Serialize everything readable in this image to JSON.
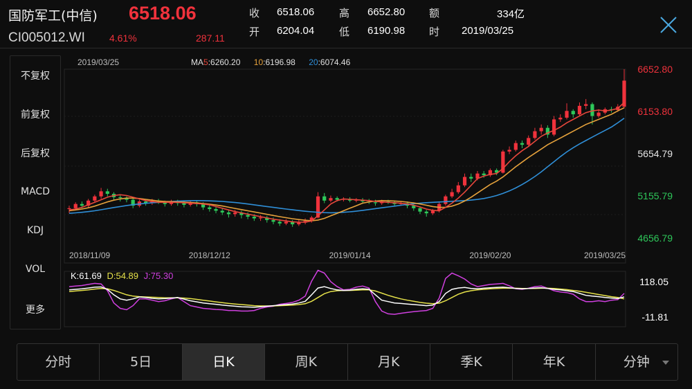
{
  "header": {
    "name": "国防军工(中信)",
    "price": "6518.06",
    "code": "CI005012.WI",
    "change_pct": "4.61%",
    "change_abs": "287.11",
    "stats": [
      {
        "label": "收",
        "value": "6518.06"
      },
      {
        "label": "高",
        "value": "6652.80"
      },
      {
        "label": "额",
        "value": "334亿"
      },
      {
        "label": "开",
        "value": "6204.04"
      },
      {
        "label": "低",
        "value": "6190.98"
      },
      {
        "label": "时",
        "value": "2019/03/25"
      }
    ]
  },
  "sidebar": {
    "items": [
      {
        "label": "不复权",
        "active": true
      },
      {
        "label": "前复权",
        "active": false
      },
      {
        "label": "后复权",
        "active": false
      },
      {
        "label": "MACD",
        "active": false
      },
      {
        "label": "KDJ",
        "active": true
      },
      {
        "label": "VOL",
        "active": false
      },
      {
        "label": "更多",
        "active": false
      }
    ]
  },
  "tabs": [
    {
      "label": "分时",
      "active": false
    },
    {
      "label": "5日",
      "active": false
    },
    {
      "label": "日K",
      "active": true
    },
    {
      "label": "周K",
      "active": false
    },
    {
      "label": "月K",
      "active": false
    },
    {
      "label": "季K",
      "active": false
    },
    {
      "label": "年K",
      "active": false
    },
    {
      "label": "分钟",
      "active": false,
      "dropdown": true
    }
  ],
  "colors": {
    "up": "#f0323c",
    "down": "#2ec85a",
    "ma5": "#e8473c",
    "ma10": "#e6a23c",
    "ma20": "#2f8fd8",
    "k": "#ffffff",
    "d": "#e6e24a",
    "j": "#d040e0",
    "accent": "#3aa0e8"
  },
  "chart_data": [
    {
      "type": "candlestick",
      "top_date": "2019/03/25",
      "ma_legend": [
        {
          "prefix": "MA",
          "key": "5",
          "value": "6260.20"
        },
        {
          "prefix": "",
          "key": "10",
          "value": "6196.98"
        },
        {
          "prefix": "",
          "key": "20",
          "value": "6074.46"
        }
      ],
      "y_ticks": [
        {
          "label": "6652.80",
          "value": 6652.8,
          "color": "up"
        },
        {
          "label": "6153.80",
          "value": 6153.8,
          "color": "up"
        },
        {
          "label": "5654.79",
          "value": 5654.79,
          "color": "neutral"
        },
        {
          "label": "5155.79",
          "value": 5155.79,
          "color": "down"
        },
        {
          "label": "4656.79",
          "value": 4656.79,
          "color": "down"
        }
      ],
      "ylim": [
        4656.79,
        6652.8
      ],
      "x_ticks": [
        {
          "label": "2018/11/09",
          "index": 0
        },
        {
          "label": "2018/12/12",
          "index": 22
        },
        {
          "label": "2019/01/14",
          "index": 44
        },
        {
          "label": "2019/02/20",
          "index": 66
        },
        {
          "label": "2019/03/25",
          "index": 87
        }
      ],
      "candles": [
        [
          5000,
          5010,
          4950,
          5040
        ],
        [
          5010,
          5060,
          4990,
          5080
        ],
        [
          5060,
          5040,
          5010,
          5090
        ],
        [
          5040,
          5100,
          5020,
          5120
        ],
        [
          5100,
          5150,
          5080,
          5170
        ],
        [
          5150,
          5210,
          5120,
          5250
        ],
        [
          5210,
          5180,
          5150,
          5240
        ],
        [
          5180,
          5140,
          5110,
          5200
        ],
        [
          5140,
          5130,
          5090,
          5170
        ],
        [
          5130,
          5110,
          5080,
          5150
        ],
        [
          5110,
          5040,
          5010,
          5130
        ],
        [
          5040,
          5090,
          5020,
          5110
        ],
        [
          5090,
          5070,
          5040,
          5110
        ],
        [
          5070,
          5100,
          5050,
          5120
        ],
        [
          5100,
          5080,
          5060,
          5120
        ],
        [
          5080,
          5060,
          5030,
          5100
        ],
        [
          5060,
          5090,
          5040,
          5110
        ],
        [
          5090,
          5070,
          5040,
          5110
        ],
        [
          5070,
          5050,
          5020,
          5100
        ],
        [
          5050,
          5080,
          5030,
          5100
        ],
        [
          5080,
          5060,
          5030,
          5100
        ],
        [
          5060,
          5020,
          4990,
          5080
        ],
        [
          5020,
          5000,
          4970,
          5050
        ],
        [
          5000,
          4980,
          4950,
          5030
        ],
        [
          4980,
          4960,
          4930,
          5010
        ],
        [
          4960,
          4940,
          4900,
          4990
        ],
        [
          4940,
          4960,
          4910,
          4990
        ],
        [
          4960,
          4930,
          4890,
          4980
        ],
        [
          4930,
          4910,
          4880,
          4960
        ],
        [
          4910,
          4890,
          4860,
          4940
        ],
        [
          4890,
          4900,
          4860,
          4930
        ],
        [
          4900,
          4870,
          4840,
          4920
        ],
        [
          4870,
          4850,
          4820,
          4900
        ],
        [
          4850,
          4830,
          4800,
          4880
        ],
        [
          4830,
          4850,
          4810,
          4880
        ],
        [
          4850,
          4820,
          4790,
          4870
        ],
        [
          4820,
          4840,
          4800,
          4870
        ],
        [
          4840,
          4860,
          4820,
          4890
        ],
        [
          4860,
          4900,
          4840,
          4920
        ],
        [
          4900,
          5150,
          4890,
          5200
        ],
        [
          5150,
          5100,
          5070,
          5190
        ],
        [
          5100,
          5130,
          5080,
          5160
        ],
        [
          5130,
          5110,
          5090,
          5150
        ],
        [
          5110,
          5120,
          5090,
          5140
        ],
        [
          5120,
          5100,
          5080,
          5140
        ],
        [
          5100,
          5110,
          5080,
          5130
        ],
        [
          5110,
          5090,
          5070,
          5130
        ],
        [
          5090,
          5080,
          5060,
          5120
        ],
        [
          5080,
          5070,
          5040,
          5110
        ],
        [
          5070,
          5090,
          5050,
          5110
        ],
        [
          5090,
          5080,
          5060,
          5110
        ],
        [
          5080,
          5060,
          5040,
          5100
        ],
        [
          5060,
          5070,
          5040,
          5090
        ],
        [
          5070,
          5040,
          5010,
          5090
        ],
        [
          5040,
          5010,
          4980,
          5060
        ],
        [
          5010,
          4970,
          4940,
          5030
        ],
        [
          4970,
          4950,
          4910,
          4990
        ],
        [
          4950,
          4980,
          4930,
          5000
        ],
        [
          4980,
          5060,
          4960,
          5080
        ],
        [
          5060,
          5150,
          5040,
          5170
        ],
        [
          5150,
          5200,
          5130,
          5240
        ],
        [
          5200,
          5280,
          5180,
          5320
        ],
        [
          5280,
          5380,
          5260,
          5420
        ],
        [
          5380,
          5360,
          5320,
          5420
        ],
        [
          5360,
          5420,
          5340,
          5450
        ],
        [
          5420,
          5400,
          5370,
          5450
        ],
        [
          5400,
          5460,
          5380,
          5480
        ],
        [
          5460,
          5430,
          5400,
          5480
        ],
        [
          5430,
          5680,
          5420,
          5700
        ],
        [
          5680,
          5700,
          5650,
          5740
        ],
        [
          5700,
          5780,
          5680,
          5810
        ],
        [
          5780,
          5760,
          5720,
          5810
        ],
        [
          5760,
          5840,
          5740,
          5870
        ],
        [
          5840,
          5920,
          5820,
          5960
        ],
        [
          5920,
          5960,
          5880,
          6000
        ],
        [
          5960,
          5880,
          5840,
          5990
        ],
        [
          5880,
          6060,
          5860,
          6100
        ],
        [
          6060,
          6080,
          6030,
          6120
        ],
        [
          6080,
          6160,
          6060,
          6250
        ],
        [
          6160,
          6120,
          6080,
          6180
        ],
        [
          6120,
          6220,
          6100,
          6260
        ],
        [
          6220,
          6240,
          6180,
          6300
        ],
        [
          6240,
          6100,
          6000,
          6260
        ],
        [
          6100,
          6140,
          6080,
          6180
        ],
        [
          6140,
          6180,
          6120,
          6200
        ],
        [
          6180,
          6170,
          6140,
          6210
        ],
        [
          6170,
          6210,
          6150,
          6240
        ],
        [
          6210,
          6518.06,
          6190.98,
          6652.8
        ]
      ],
      "ma5": [
        4990,
        5000,
        5020,
        5050,
        5080,
        5110,
        5140,
        5160,
        5170,
        5160,
        5140,
        5120,
        5100,
        5090,
        5080,
        5080,
        5080,
        5080,
        5075,
        5070,
        5065,
        5060,
        5050,
        5030,
        5010,
        4990,
        4970,
        4955,
        4940,
        4925,
        4910,
        4895,
        4880,
        4870,
        4860,
        4850,
        4845,
        4845,
        4860,
        4920,
        4990,
        5060,
        5100,
        5120,
        5115,
        5110,
        5105,
        5100,
        5090,
        5085,
        5080,
        5075,
        5070,
        5060,
        5045,
        5025,
        5000,
        4985,
        4980,
        5020,
        5070,
        5130,
        5200,
        5280,
        5360,
        5390,
        5410,
        5420,
        5480,
        5560,
        5630,
        5690,
        5740,
        5800,
        5860,
        5900,
        5930,
        5970,
        6020,
        6060,
        6100,
        6140,
        6160,
        6170,
        6160,
        6170,
        6190,
        6260
      ],
      "ma10": [
        4980,
        4990,
        5000,
        5015,
        5035,
        5060,
        5085,
        5105,
        5120,
        5130,
        5130,
        5125,
        5115,
        5105,
        5095,
        5090,
        5088,
        5085,
        5082,
        5078,
        5072,
        5066,
        5058,
        5048,
        5036,
        5022,
        5008,
        4994,
        4980,
        4966,
        4952,
        4938,
        4924,
        4910,
        4898,
        4886,
        4876,
        4868,
        4862,
        4870,
        4890,
        4920,
        4950,
        4980,
        5010,
        5040,
        5070,
        5085,
        5095,
        5100,
        5098,
        5095,
        5090,
        5082,
        5072,
        5060,
        5045,
        5030,
        5020,
        5022,
        5035,
        5060,
        5095,
        5140,
        5190,
        5240,
        5290,
        5330,
        5380,
        5440,
        5500,
        5555,
        5610,
        5660,
        5710,
        5760,
        5800,
        5840,
        5880,
        5920,
        5960,
        6000,
        6030,
        6060,
        6090,
        6120,
        6160,
        6197
      ],
      "ma20": [
        4950,
        4955,
        4962,
        4970,
        4980,
        4992,
        5005,
        5018,
        5030,
        5042,
        5052,
        5060,
        5068,
        5074,
        5080,
        5085,
        5090,
        5094,
        5097,
        5099,
        5100,
        5099,
        5097,
        5094,
        5090,
        5084,
        5077,
        5069,
        5060,
        5050,
        5040,
        5030,
        5020,
        5010,
        5000,
        4991,
        4982,
        4974,
        4968,
        4962,
        4958,
        4956,
        4958,
        4962,
        4968,
        4975,
        4985,
        4995,
        5005,
        5015,
        5025,
        5035,
        5045,
        5055,
        5063,
        5070,
        5076,
        5080,
        5084,
        5088,
        5092,
        5096,
        5100,
        5106,
        5114,
        5125,
        5140,
        5160,
        5185,
        5215,
        5250,
        5290,
        5335,
        5385,
        5440,
        5500,
        5560,
        5620,
        5675,
        5725,
        5770,
        5810,
        5850,
        5890,
        5930,
        5970,
        6020,
        6074
      ]
    },
    {
      "type": "line",
      "legend": [
        {
          "key": "K",
          "value": "61.69",
          "series": "k"
        },
        {
          "key": "D",
          "value": "54.89",
          "series": "d"
        },
        {
          "key": "J",
          "value": "75.30",
          "series": "j"
        }
      ],
      "y_ticks": [
        {
          "label": "118.05",
          "value": 118.05
        },
        {
          "label": "-11.81",
          "value": -11.81
        }
      ],
      "ylim": [
        -11.81,
        118.05
      ],
      "k": [
        88,
        90,
        92,
        95,
        98,
        99,
        90,
        70,
        55,
        50,
        55,
        62,
        60,
        57,
        55,
        56,
        58,
        60,
        54,
        48,
        44,
        40,
        37,
        35,
        32,
        30,
        28,
        26,
        25,
        24,
        26,
        28,
        30,
        32,
        34,
        36,
        40,
        46,
        70,
        95,
        100,
        93,
        88,
        86,
        87,
        90,
        92,
        90,
        70,
        50,
        45,
        40,
        38,
        36,
        34,
        32,
        30,
        32,
        45,
        75,
        90,
        95,
        97,
        93,
        92,
        94,
        96,
        97,
        98,
        96,
        93,
        92,
        93,
        95,
        96,
        93,
        90,
        88,
        85,
        82,
        75,
        68,
        65,
        63,
        60,
        58,
        56,
        62
      ],
      "d": [
        82,
        84,
        86,
        88,
        91,
        93,
        92,
        86,
        78,
        70,
        65,
        63,
        62,
        61,
        60,
        59,
        59,
        59,
        58,
        56,
        53,
        50,
        47,
        44,
        41,
        38,
        36,
        34,
        32,
        30,
        29,
        29,
        29,
        30,
        31,
        32,
        34,
        37,
        46,
        60,
        74,
        82,
        85,
        86,
        86,
        87,
        88,
        88,
        84,
        76,
        68,
        61,
        55,
        50,
        46,
        42,
        39,
        37,
        39,
        48,
        60,
        72,
        80,
        85,
        88,
        90,
        92,
        93,
        94,
        94,
        94,
        93,
        93,
        93,
        94,
        94,
        93,
        91,
        89,
        86,
        83,
        79,
        75,
        71,
        67,
        63,
        60,
        55
      ],
      "j": [
        100,
        102,
        104,
        108,
        112,
        110,
        85,
        40,
        20,
        15,
        30,
        55,
        55,
        50,
        45,
        48,
        55,
        60,
        45,
        30,
        25,
        20,
        18,
        16,
        15,
        12,
        12,
        10,
        10,
        12,
        20,
        25,
        28,
        35,
        38,
        42,
        50,
        65,
        120,
        160,
        150,
        118,
        100,
        88,
        90,
        98,
        102,
        95,
        45,
        10,
        0,
        -2,
        2,
        5,
        8,
        10,
        12,
        20,
        58,
        130,
        150,
        140,
        128,
        110,
        100,
        104,
        108,
        110,
        112,
        103,
        92,
        90,
        94,
        100,
        102,
        94,
        85,
        80,
        78,
        72,
        55,
        45,
        45,
        48,
        45,
        50,
        52,
        75
      ]
    }
  ]
}
